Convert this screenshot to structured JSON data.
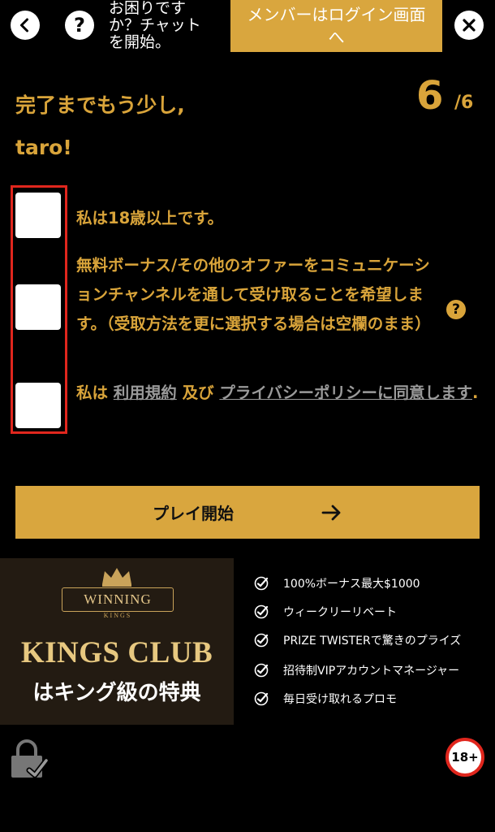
{
  "header": {
    "help_text": "お困りですか？チャットを開始。",
    "login_button": "メンバーはログイン画面へ"
  },
  "heading": {
    "line1": "完了までもう少し,",
    "line2": "taro!",
    "step_current": "6",
    "step_total": "/6"
  },
  "consents": {
    "age": "私は18歳以上です。",
    "marketing": "無料ボーナス/その他のオファーをコミュニケーションチャンネルを通して受け取ることを希望します。（受取方法を更に選択する場合は空欄のまま）",
    "terms_prefix": "私は ",
    "terms_link": "利用規約",
    "terms_and": " 及び ",
    "privacy_link": "プライバシーポリシーに同意します",
    "terms_suffix": "."
  },
  "help_icon": "?",
  "play_button": "プレイ開始",
  "banner": {
    "brand_top": "WINNING",
    "brand_sub": "KINGS",
    "club": "KINGS CLUB",
    "tagline": "はキング級の特典"
  },
  "features": [
    "100%ボーナス最大$1000",
    "ウィークリーリベート",
    "PRIZE TWISTERで驚きのプライズ",
    "招待制VIPアカウントマネージャー",
    "毎日受け取れるプロモ"
  ],
  "age_badge": "18+",
  "colors": {
    "accent": "#d9a63e",
    "danger": "#e0261d",
    "background": "#000000"
  },
  "icons": [
    "back-icon",
    "help-icon",
    "close-icon",
    "arrow-right-icon",
    "check-icon",
    "crown-icon",
    "lock-icon"
  ]
}
